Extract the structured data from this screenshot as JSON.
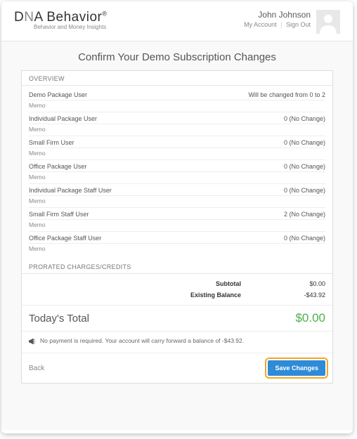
{
  "header": {
    "logo_main": "DNA Behavior",
    "logo_reg": "®",
    "logo_sub": "Behavior and Money Insights",
    "user_name": "John Johnson",
    "my_account": "My Account",
    "sign_out": "Sign Out"
  },
  "main": {
    "title": "Confirm Your Demo Subscription Changes",
    "overview_head": "OVERVIEW",
    "items": [
      {
        "name": "Demo Package User",
        "status": "Will be changed from 0 to 2",
        "memo": "Memo"
      },
      {
        "name": "Individual Package User",
        "status": "0 (No Change)",
        "memo": "Memo"
      },
      {
        "name": "Small Firm User",
        "status": "0 (No Change)",
        "memo": "Memo"
      },
      {
        "name": "Office Package User",
        "status": "0 (No Change)",
        "memo": "Memo"
      },
      {
        "name": "Individual Package Staff User",
        "status": "0 (No Change)",
        "memo": "Memo"
      },
      {
        "name": "Small Firm Staff User",
        "status": "2 (No Change)",
        "memo": "Memo"
      },
      {
        "name": "Office Package Staff User",
        "status": "0 (No Change)",
        "memo": "Memo"
      }
    ],
    "charges_head": "PRORATED CHARGES/CREDITS",
    "subtotal_label": "Subtotal",
    "subtotal_value": "$0.00",
    "balance_label": "Existing Balance",
    "balance_value": "-$43.92",
    "total_label": "Today's Total",
    "total_value": "$0.00",
    "notice": "No payment is required. Your account will carry forward a balance of -$43.92.",
    "back": "Back",
    "save": "Save Changes"
  }
}
